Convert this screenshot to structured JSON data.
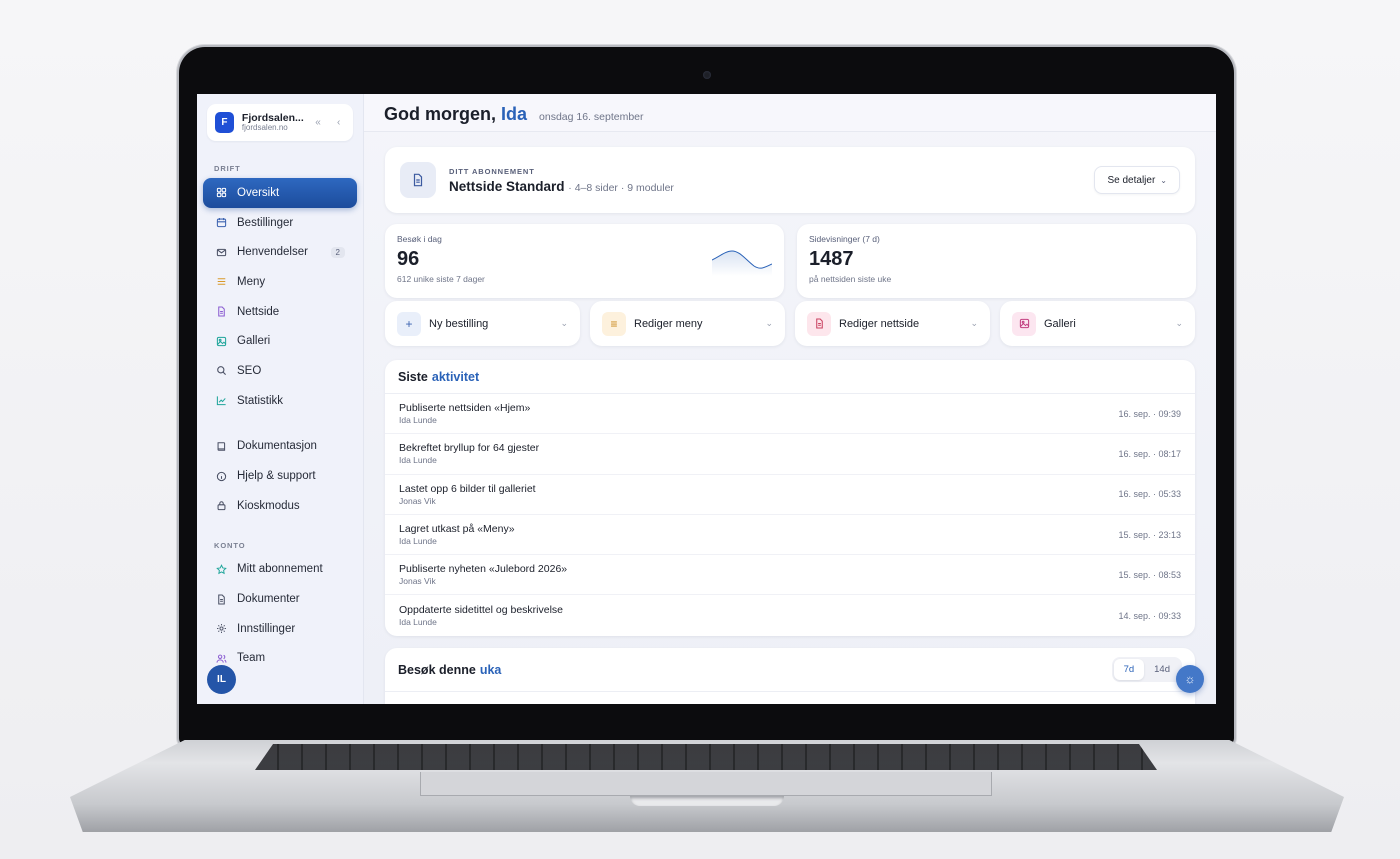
{
  "brand": {
    "name": "Fjordsalen...",
    "domain": "fjordsalen.no",
    "logo_letter": "F"
  },
  "sidebar": {
    "section_drift": "DRIFT",
    "section_konto": "KONTO",
    "drift_items": [
      {
        "label": "Oversikt",
        "icon": "grid-icon"
      },
      {
        "label": "Bestillinger",
        "icon": "calendar-icon"
      },
      {
        "label": "Henvendelser",
        "icon": "mail-icon",
        "badge": "2"
      },
      {
        "label": "Meny",
        "icon": "menu-lines-icon"
      },
      {
        "label": "Nettside",
        "icon": "page-icon"
      },
      {
        "label": "Galleri",
        "icon": "image-icon"
      },
      {
        "label": "SEO",
        "icon": "search-icon"
      },
      {
        "label": "Statistikk",
        "icon": "chart-icon"
      }
    ],
    "help_items": [
      {
        "label": "Dokumentasjon",
        "icon": "book-icon"
      },
      {
        "label": "Hjelp & support",
        "icon": "info-icon"
      },
      {
        "label": "Kioskmodus",
        "icon": "lock-icon"
      }
    ],
    "konto_items": [
      {
        "label": "Mitt abonnement",
        "icon": "star-icon"
      },
      {
        "label": "Dokumenter",
        "icon": "document-icon"
      },
      {
        "label": "Innstillinger",
        "icon": "gear-icon"
      },
      {
        "label": "Team",
        "icon": "users-icon"
      }
    ],
    "avatar_initials": "IL"
  },
  "header": {
    "greeting": "God morgen,",
    "name": "Ida",
    "date": "onsdag 16. september"
  },
  "subscription": {
    "eyebrow": "DITT ABONNEMENT",
    "plan": "Nettside Standard",
    "meta": "· 4–8 sider · 9 moduler",
    "details_label": "Se detaljer"
  },
  "stats": [
    {
      "label": "Besøk i dag",
      "value": "96",
      "sub": "612 unike siste 7 dager"
    },
    {
      "label": "Sidevisninger (7 d)",
      "value": "1487",
      "sub": "på nettsiden siste uke"
    }
  ],
  "actions": [
    {
      "label": "Ny bestilling",
      "icon": "plus-icon",
      "bg": "#e9effa",
      "fg": "#3c63b0"
    },
    {
      "label": "Rediger meny",
      "icon": "menu-lines-icon",
      "bg": "#fdf1dd",
      "fg": "#c9891c"
    },
    {
      "label": "Rediger nettside",
      "icon": "page-edit-icon",
      "bg": "#fde6ec",
      "fg": "#c9405f"
    },
    {
      "label": "Galleri",
      "icon": "image-icon",
      "bg": "#fce6f0",
      "fg": "#c23f80"
    }
  ],
  "activity": {
    "title": "Siste",
    "title_accent": "aktivitet",
    "rows": [
      {
        "title": "Publiserte nettsiden «Hjem»",
        "user": "Ida Lunde",
        "time": "16. sep. · 09:39"
      },
      {
        "title": "Bekreftet bryllup for 64 gjester",
        "user": "Ida Lunde",
        "time": "16. sep. · 08:17"
      },
      {
        "title": "Lastet opp 6 bilder til galleriet",
        "user": "Jonas Vik",
        "time": "16. sep. · 05:33"
      },
      {
        "title": "Lagret utkast på «Meny»",
        "user": "Ida Lunde",
        "time": "15. sep. · 23:13"
      },
      {
        "title": "Publiserte nyheten «Julebord 2026»",
        "user": "Jonas Vik",
        "time": "15. sep. · 08:53"
      },
      {
        "title": "Oppdaterte sidetittel og beskrivelse",
        "user": "Ida Lunde",
        "time": "14. sep. · 09:33"
      }
    ]
  },
  "visits": {
    "title": "Besøk denne",
    "title_accent": "uka",
    "range_options": [
      "7d",
      "14d"
    ],
    "range_selected": "7d"
  },
  "colors": {
    "accent": "#2a62b8",
    "active_nav": "#1c4c9c",
    "brand_logo": "#1f4fd6"
  }
}
